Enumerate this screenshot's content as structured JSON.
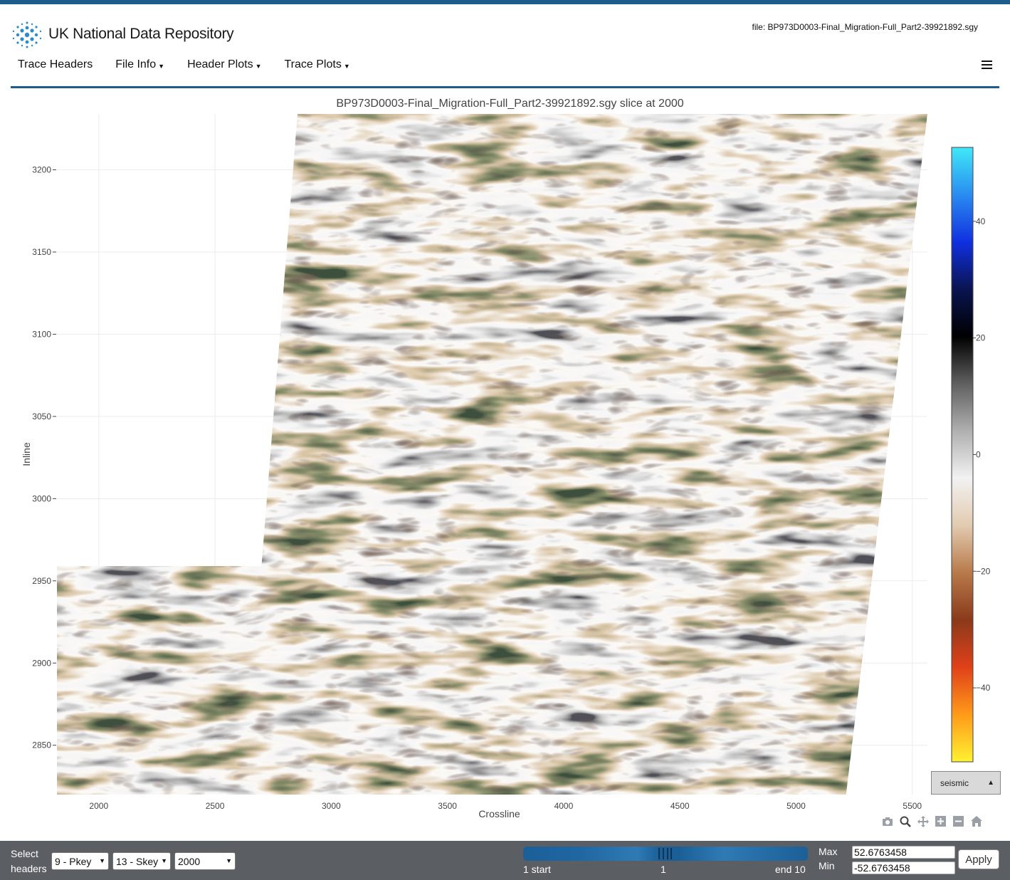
{
  "header": {
    "brand": "UK National Data Repository",
    "file_label": "file: BP973D0003-Final_Migration-Full_Part2-39921892.sgy"
  },
  "nav": {
    "items": [
      {
        "label": "Trace Headers",
        "dropdown": false
      },
      {
        "label": "File Info",
        "dropdown": true
      },
      {
        "label": "Header Plots",
        "dropdown": true
      },
      {
        "label": "Trace Plots",
        "dropdown": true
      }
    ]
  },
  "chart_data": {
    "type": "heatmap",
    "title": "BP973D0003-Final_Migration-Full_Part2-39921892.sgy slice at 2000",
    "xlabel": "Crossline",
    "ylabel": "Inline",
    "xlim": [
      1820,
      5565
    ],
    "ylim": [
      2820,
      3234
    ],
    "x_ticks": [
      2000,
      2500,
      3000,
      3500,
      4000,
      4500,
      5000,
      5500
    ],
    "y_ticks": [
      2850,
      2900,
      2950,
      3000,
      3050,
      3100,
      3150,
      3200
    ],
    "grid": true,
    "colorscale": "seismic",
    "colorbar": {
      "range": [
        -52.6763458,
        52.6763458
      ],
      "ticks": [
        40,
        20,
        0,
        -20,
        -40
      ],
      "tick_labels": [
        "40",
        "20",
        "0",
        "−20",
        "−40"
      ],
      "stops": [
        "#fff230",
        "#ff9a1a",
        "#e0401a",
        "#8a3a1a",
        "#b87a4a",
        "#e2cbb0",
        "#f2f2f2",
        "#b0b0b0",
        "#606060",
        "#000000",
        "#0a1450",
        "#1030e0",
        "#2a8cf0",
        "#40e8f8"
      ]
    },
    "survey_outline": [
      [
        1820,
        2820
      ],
      [
        5215,
        2820
      ],
      [
        5565,
        3234
      ],
      [
        2855,
        3234
      ],
      [
        2700,
        2959
      ],
      [
        1820,
        2959
      ]
    ]
  },
  "colormap_selector": {
    "value": "seismic"
  },
  "modebar": {
    "icons": [
      "camera-icon",
      "zoom-icon",
      "pan-icon",
      "zoom-in-icon",
      "zoom-out-icon",
      "home-icon"
    ]
  },
  "footer": {
    "select_label_1": "Select",
    "select_label_2": "headers",
    "pkey": "9 - Pkey",
    "skey": "13 - Skey",
    "slice": "2000",
    "slider_start": "1 start",
    "slider_mid": "1",
    "slider_end": "end 10",
    "max_label": "Max",
    "min_label": "Min",
    "max_value": "52.6763458",
    "min_value": "-52.6763458",
    "apply_label": "Apply"
  }
}
